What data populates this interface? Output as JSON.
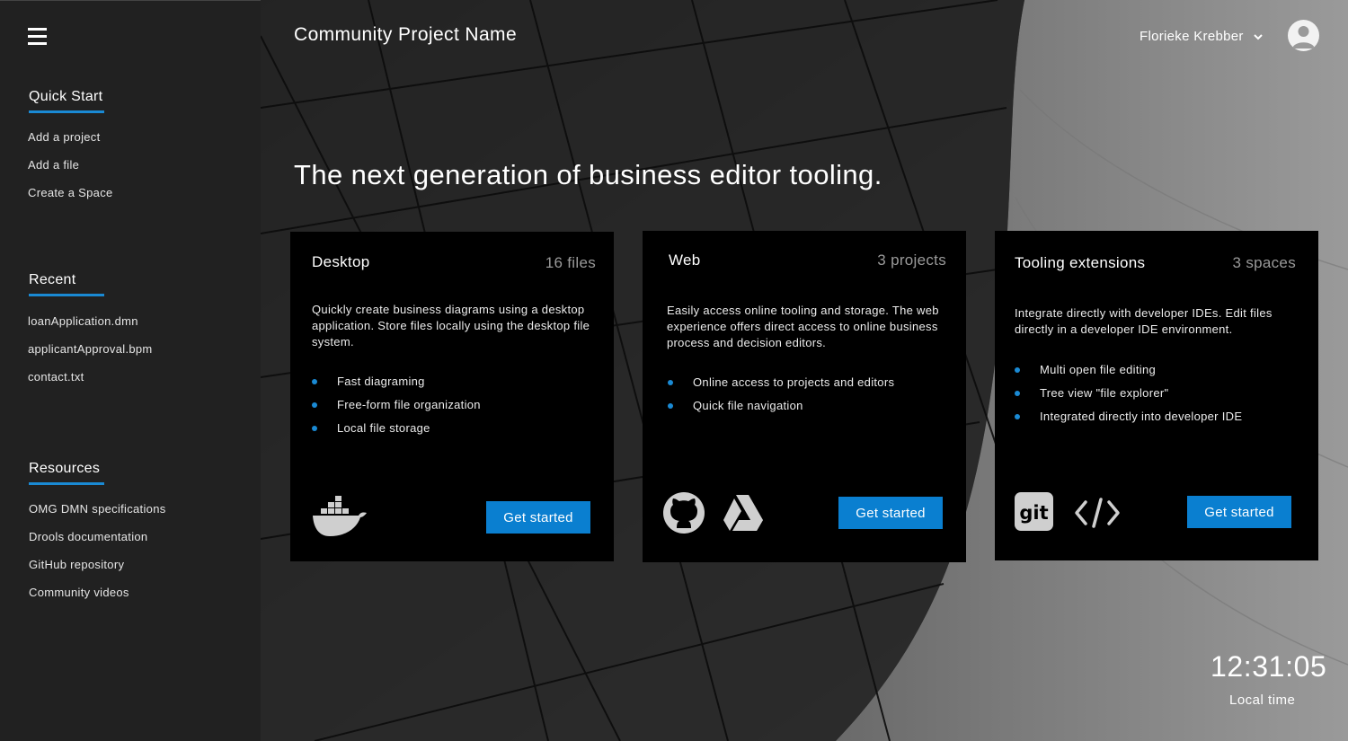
{
  "sidebar": {
    "sections": [
      {
        "heading": "Quick Start",
        "links": [
          "Add a project",
          "Add a file",
          "Create a Space"
        ]
      },
      {
        "heading": "Recent",
        "links": [
          "loanApplication.dmn",
          "applicantApproval.bpm",
          "contact.txt"
        ]
      },
      {
        "heading": "Resources",
        "links": [
          "OMG DMN specifications",
          "Drools documentation",
          "GitHub repository",
          "Community videos"
        ]
      }
    ]
  },
  "header": {
    "project_name": "Community Project Name",
    "user_name": "Florieke Krebber"
  },
  "hero": "The next generation of business editor tooling.",
  "cards": [
    {
      "title": "Desktop",
      "count": "16 files",
      "description": "Quickly create business diagrams using a desktop application. Store files locally using the desktop file system.",
      "features": [
        "Fast diagraming",
        "Free-form file organization",
        "Local file storage"
      ],
      "button": "Get started",
      "logos": [
        "docker-icon"
      ]
    },
    {
      "title": "Web",
      "count": "3 projects",
      "description": "Easily access online tooling and storage. The web experience offers direct access to online business process and decision editors.",
      "features": [
        "Online access to projects and editors",
        "Quick file navigation"
      ],
      "button": "Get started",
      "logos": [
        "github-icon",
        "google-drive-icon"
      ]
    },
    {
      "title": "Tooling extensions",
      "count": "3 spaces",
      "description": "Integrate directly with developer IDEs. Edit files directly in a developer IDE environment.",
      "features": [
        "Multi open file editing",
        "Tree view \"file explorer\"",
        "Integrated directly into developer IDE"
      ],
      "button": "Get started",
      "logos": [
        "git-icon",
        "code-icon"
      ]
    }
  ],
  "clock": {
    "time": "12:31:05",
    "label": "Local  time"
  },
  "colors": {
    "accent": "#0a7fd0",
    "sidebar_bg": "#212121",
    "card_bg": "#000000"
  }
}
